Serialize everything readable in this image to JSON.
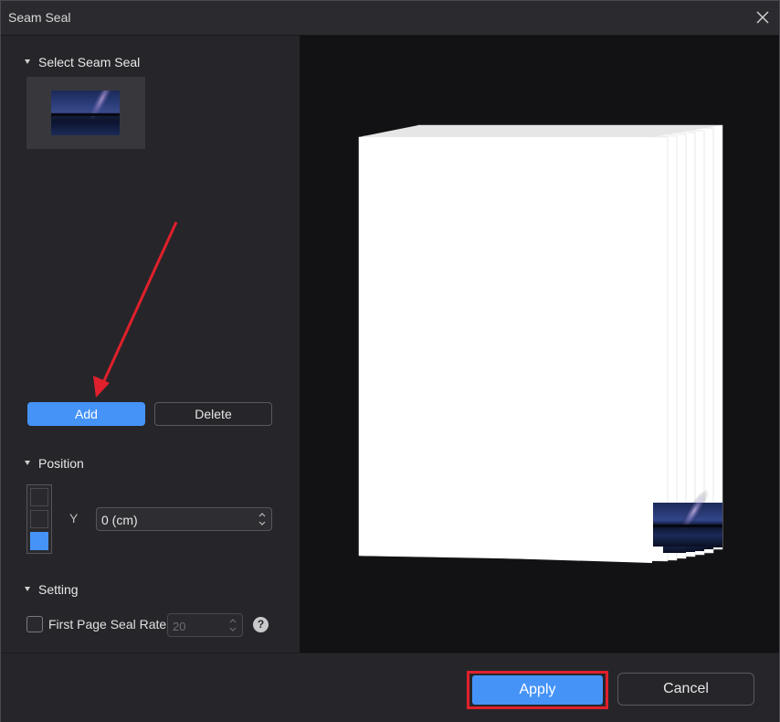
{
  "window": {
    "title": "Seam Seal",
    "close_icon": "close-icon"
  },
  "left_panel": {
    "select_section": {
      "heading": "Select Seam Seal",
      "selected_thumbnail": "night-sky-lake-image"
    },
    "actions": {
      "add_label": "Add",
      "delete_label": "Delete"
    },
    "position_section": {
      "heading": "Position",
      "grid_cells": [
        "top",
        "middle",
        "bottom"
      ],
      "selected_cell": "bottom",
      "y_label": "Y",
      "y_value": "0 (cm)"
    },
    "setting_section": {
      "heading": "Setting",
      "first_page_seal_rate_label": "First Page Seal Rate",
      "first_page_seal_rate_checked": false,
      "first_page_seal_rate_value": "20",
      "help_icon_text": "?"
    }
  },
  "preview": {
    "description": "",
    "seal_image": "night-sky-lake-image"
  },
  "footer": {
    "apply_label": "Apply",
    "cancel_label": "Cancel"
  },
  "colors": {
    "accent": "#4593f7",
    "highlight_frame": "#e0202c",
    "annotation_arrow": "#e0202c"
  }
}
